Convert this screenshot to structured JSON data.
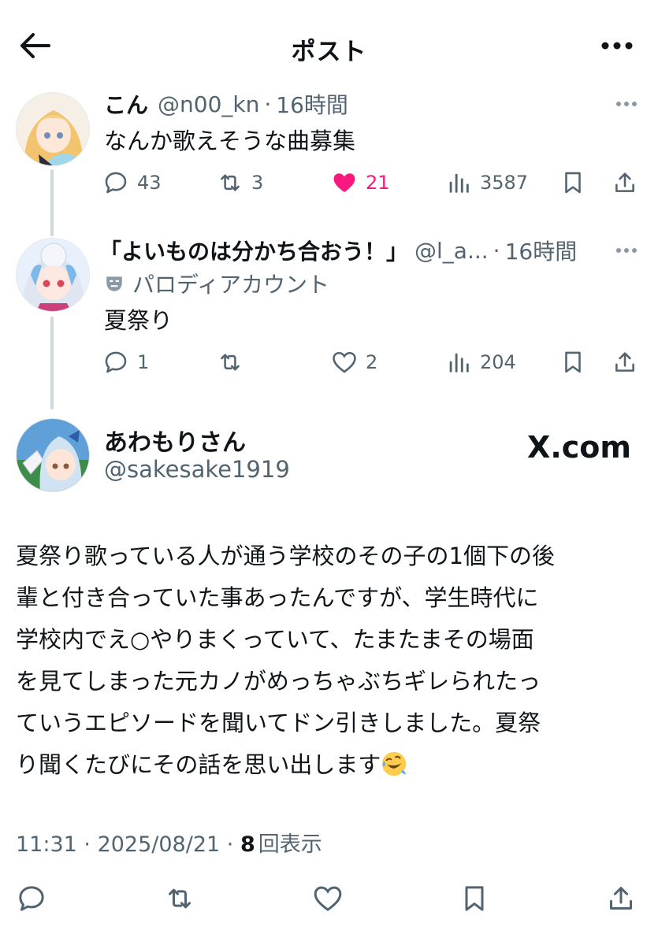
{
  "header": {
    "title": "ポスト",
    "back_icon": "arrow-left-icon",
    "more_icon": "more-horizontal-icon"
  },
  "replies": [
    {
      "name": "こん",
      "handle": "@n00_kn",
      "dot": "·",
      "time": "16時間",
      "text": "なんか歌えそうな曲募集",
      "stats": {
        "replies": "43",
        "reposts": "3",
        "likes": "21",
        "views": "3587"
      },
      "liked": true
    },
    {
      "name": "「よいものは分かち合おう！」",
      "handle": "@l_a...",
      "dot": "·",
      "time": "16時間",
      "badge": "パロディアカウント",
      "text": "夏祭り",
      "stats": {
        "replies": "1",
        "reposts": "",
        "likes": "2",
        "views": "204"
      },
      "liked": false
    }
  ],
  "main_post": {
    "name": "あわもりさん",
    "handle": "@sakesake1919",
    "watermark": "X.com",
    "lines": [
      "夏祭り歌っている人が通う学校のその子の1個下の後",
      "輩と付き合っていた事あったんですが、学生時代に",
      "学校内でえ○やりまくっていて、たまたまその場面",
      "を見てしまった元カノがめっちゃぶちギレられたっ",
      "ていうエピソードを聞いてドン引きしました。夏祭",
      "り聞くたびにその話を思い出します"
    ],
    "emoji": "rolling-on-the-floor-laughing-emoji",
    "time": "11:31",
    "date": "2025/08/21",
    "views_count": "8",
    "views_label": "回表示"
  },
  "colors": {
    "text": "#0f1419",
    "secondary": "#536471",
    "like": "#f91880",
    "thread": "#cfd9de"
  }
}
